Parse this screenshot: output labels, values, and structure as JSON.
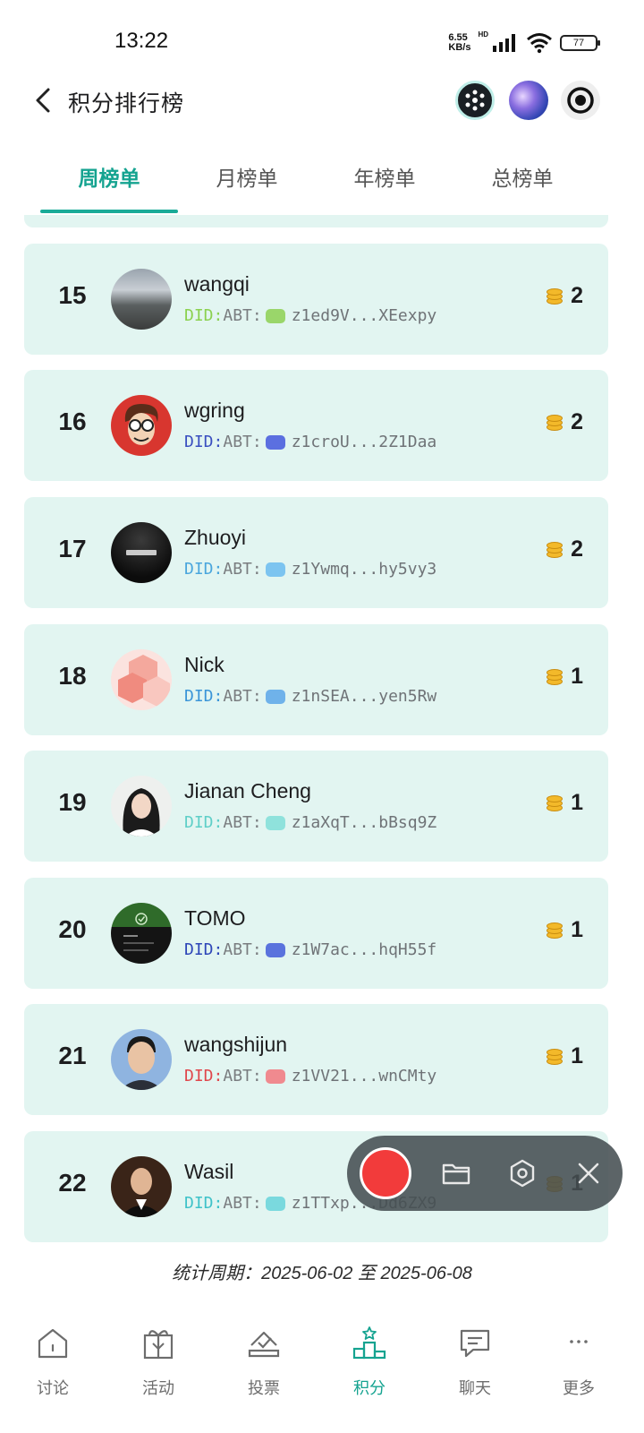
{
  "status_bar": {
    "time": "13:22",
    "net_speed_value": "6.55",
    "net_speed_unit": "KB/s",
    "hd_label": "HD",
    "battery": "77"
  },
  "header": {
    "title": "积分排行榜"
  },
  "tabs": [
    {
      "label": "周榜单",
      "active": true
    },
    {
      "label": "月榜单",
      "active": false
    },
    {
      "label": "年榜单",
      "active": false
    },
    {
      "label": "总榜单",
      "active": false
    }
  ],
  "ranking": [
    {
      "rank": "15",
      "name": "wangqi",
      "did_prefix": "DID:",
      "did_method": "ABT:",
      "did_value": "z1ed9V...XEexpy",
      "did_color": "#8bd14f",
      "chip_color": "#9ad66a",
      "points": "2"
    },
    {
      "rank": "16",
      "name": "wgring",
      "did_prefix": "DID:",
      "did_method": "ABT:",
      "did_value": "z1croU...2Z1Daa",
      "did_color": "#3a4fc0",
      "chip_color": "#5b6fe0",
      "points": "2"
    },
    {
      "rank": "17",
      "name": "Zhuoyi",
      "did_prefix": "DID:",
      "did_method": "ABT:",
      "did_value": "z1Ywmq...hy5vy3",
      "did_color": "#4aa6dd",
      "chip_color": "#7cc4f0",
      "points": "2"
    },
    {
      "rank": "18",
      "name": "Nick",
      "did_prefix": "DID:",
      "did_method": "ABT:",
      "did_value": "z1nSEA...yen5Rw",
      "did_color": "#3b95d8",
      "chip_color": "#6fb2ea",
      "points": "1"
    },
    {
      "rank": "19",
      "name": "Jianan Cheng",
      "did_prefix": "DID:",
      "did_method": "ABT:",
      "did_value": "z1aXqT...bBsq9Z",
      "did_color": "#5fcfc8",
      "chip_color": "#8fe2dc",
      "points": "1"
    },
    {
      "rank": "20",
      "name": "TOMO",
      "did_prefix": "DID:",
      "did_method": "ABT:",
      "did_value": "z1W7ac...hqH55f",
      "did_color": "#2e46b8",
      "chip_color": "#5a73dd",
      "points": "1"
    },
    {
      "rank": "21",
      "name": "wangshijun",
      "did_prefix": "DID:",
      "did_method": "ABT:",
      "did_value": "z1VV21...wnCMty",
      "did_color": "#e0474c",
      "chip_color": "#f08a8f",
      "points": "1"
    },
    {
      "rank": "22",
      "name": "Wasil",
      "did_prefix": "DID:",
      "did_method": "ABT:",
      "did_value": "z1TTxp...Dd6ZX9",
      "did_color": "#3fc2c9",
      "chip_color": "#7ad9de",
      "points": "1"
    }
  ],
  "period": "统计周期：2025-06-02 至 2025-06-08",
  "bottom_nav": [
    {
      "label": "讨论",
      "icon": "home-icon",
      "active": false
    },
    {
      "label": "活动",
      "icon": "gift-icon",
      "active": false
    },
    {
      "label": "投票",
      "icon": "vote-icon",
      "active": false
    },
    {
      "label": "积分",
      "icon": "podium-icon",
      "active": true
    },
    {
      "label": "聊天",
      "icon": "chat-icon",
      "active": false
    },
    {
      "label": "更多",
      "icon": "more-icon",
      "active": false
    }
  ],
  "colors": {
    "accent": "#15a390",
    "card_bg": "#e2f5f1",
    "record": "#f23b3b"
  }
}
